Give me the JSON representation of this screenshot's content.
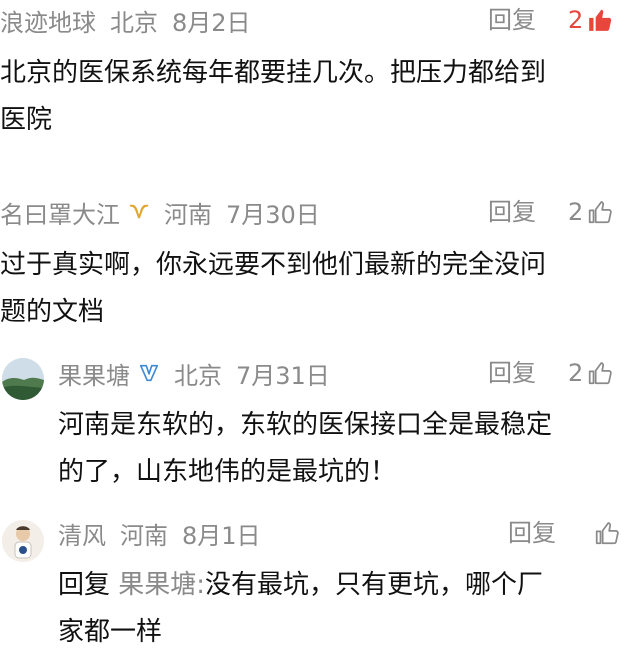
{
  "reply_label": "回复",
  "comments": [
    {
      "user": "浪迹地球",
      "location": "北京",
      "date": "8月2日",
      "likes": "2",
      "liked": true,
      "body": "北京的医保系统每年都要挂几次。把压力都给到\n医院"
    },
    {
      "user": "名曰罩大江",
      "location": "河南",
      "date": "7月30日",
      "likes": "2",
      "liked": false,
      "badge_icon": "gold-v-badge-icon",
      "body": "过于真实啊，你永远要不到他们最新的完全没问\n题的文档"
    },
    {
      "user": "果果塘",
      "location": "北京",
      "date": "7月31日",
      "likes": "2",
      "liked": false,
      "badge_icon": "blue-v-badge-icon",
      "body": "河南是东软的，东软的医保接口全是最稳定\n的了，山东地伟的是最坑的！"
    },
    {
      "user": "清风",
      "location": "河南",
      "date": "8月1日",
      "likes": "",
      "liked": false,
      "reply_prefix": "回复",
      "reply_to": "果果塘:",
      "body_line1": "没有最坑，只有更坑，哪个厂",
      "body_line2": "家都一样"
    }
  ],
  "colors": {
    "meta": "#8a8a8a",
    "liked": "#e8453c",
    "text": "#111111",
    "gold_badge": "#e0a72e",
    "blue_badge": "#3e8ad6"
  }
}
